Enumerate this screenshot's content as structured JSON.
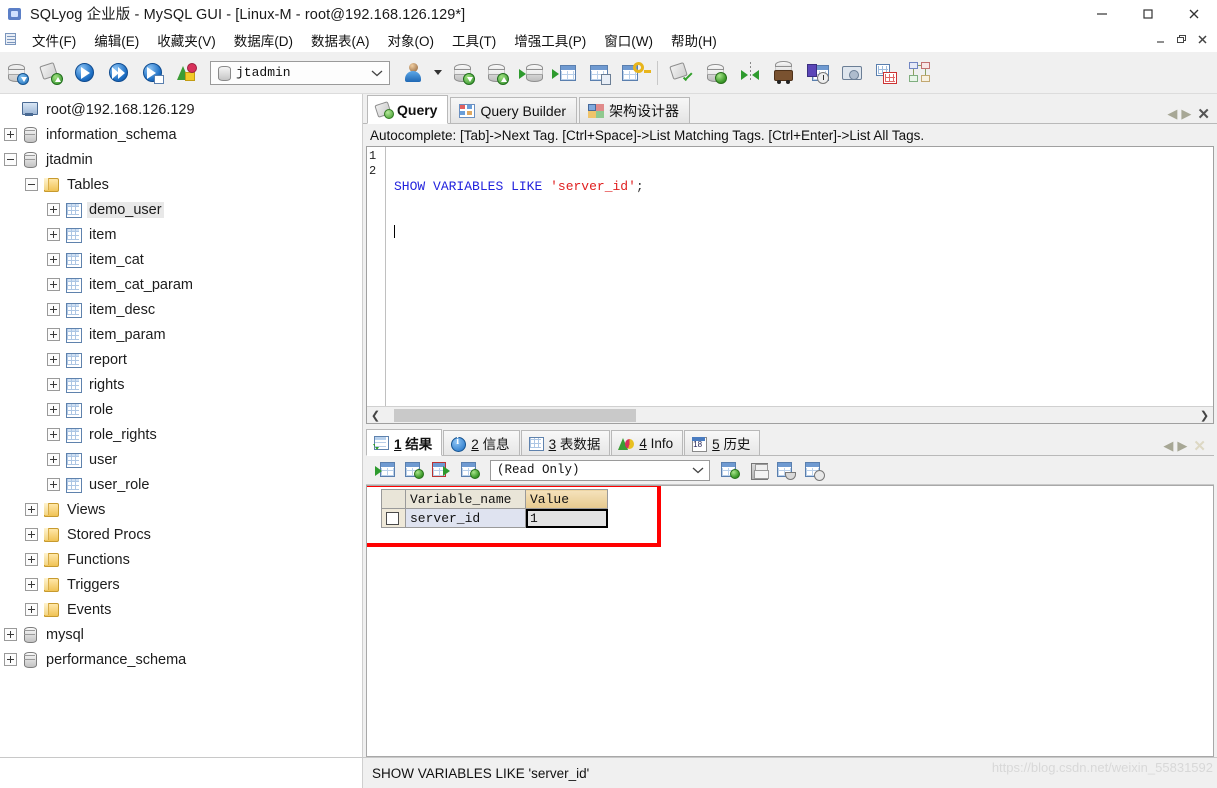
{
  "window": {
    "title": "SQLyog 企业版 - MySQL GUI - [Linux-M - root@192.168.126.129*]",
    "minimize": "—",
    "maximize": "□",
    "close": "✕",
    "mdi_minimize": "_",
    "mdi_restore": "❐",
    "mdi_close": "✕"
  },
  "menu": {
    "items": [
      {
        "label": "文件(F)",
        "mnemonic": "F"
      },
      {
        "label": "编辑(E)",
        "mnemonic": "E"
      },
      {
        "label": "收藏夹(V)",
        "mnemonic": "V"
      },
      {
        "label": "数据库(D)",
        "mnemonic": "D"
      },
      {
        "label": "数据表(A)",
        "mnemonic": "A"
      },
      {
        "label": "对象(O)",
        "mnemonic": "O"
      },
      {
        "label": "工具(T)",
        "mnemonic": "T"
      },
      {
        "label": "增强工具(P)",
        "mnemonic": "P"
      },
      {
        "label": "窗口(W)",
        "mnemonic": "W"
      },
      {
        "label": "帮助(H)",
        "mnemonic": "H"
      }
    ]
  },
  "toolbar": {
    "database_selector": {
      "value": "jtadmin",
      "chevron": "⌄"
    },
    "icons": [
      "new-connection-icon",
      "new-query-tab-icon",
      "execute-query-icon",
      "execute-all-queries-icon",
      "execute-query-new-tab-icon",
      "stop-execution-icon",
      "user-manager-icon",
      "user-manager-dropdown-icon",
      "backup-database-icon",
      "restore-database-icon",
      "import-external-data-icon",
      "export-table-data-icon",
      "table-diagnostics-icon",
      "manage-index-icon",
      "flush-icon",
      "database-sync-icon",
      "data-compare-icon",
      "migration-toolkit-icon",
      "scheduled-backup-icon",
      "sql-formatter-icon",
      "table-designer-icon",
      "schema-designer-icon"
    ]
  },
  "tree": {
    "nodes": [
      {
        "label": "root@192.168.126.129",
        "icon": "server-icon",
        "indent": 0,
        "expander": "none",
        "selected": false
      },
      {
        "label": "information_schema",
        "icon": "database-icon",
        "indent": 1,
        "expander": "plus",
        "selected": false
      },
      {
        "label": "jtadmin",
        "icon": "database-icon",
        "indent": 1,
        "expander": "minus",
        "selected": false
      },
      {
        "label": "Tables",
        "icon": "folder-icon",
        "indent": 2,
        "expander": "minus",
        "selected": false
      },
      {
        "label": "demo_user",
        "icon": "table-icon",
        "indent": 3,
        "expander": "plus",
        "selected": true
      },
      {
        "label": "item",
        "icon": "table-icon",
        "indent": 3,
        "expander": "plus",
        "selected": false
      },
      {
        "label": "item_cat",
        "icon": "table-icon",
        "indent": 3,
        "expander": "plus",
        "selected": false
      },
      {
        "label": "item_cat_param",
        "icon": "table-icon",
        "indent": 3,
        "expander": "plus",
        "selected": false
      },
      {
        "label": "item_desc",
        "icon": "table-icon",
        "indent": 3,
        "expander": "plus",
        "selected": false
      },
      {
        "label": "item_param",
        "icon": "table-icon",
        "indent": 3,
        "expander": "plus",
        "selected": false
      },
      {
        "label": "report",
        "icon": "table-icon",
        "indent": 3,
        "expander": "plus",
        "selected": false
      },
      {
        "label": "rights",
        "icon": "table-icon",
        "indent": 3,
        "expander": "plus",
        "selected": false
      },
      {
        "label": "role",
        "icon": "table-icon",
        "indent": 3,
        "expander": "plus",
        "selected": false
      },
      {
        "label": "role_rights",
        "icon": "table-icon",
        "indent": 3,
        "expander": "plus",
        "selected": false
      },
      {
        "label": "user",
        "icon": "table-icon",
        "indent": 3,
        "expander": "plus",
        "selected": false
      },
      {
        "label": "user_role",
        "icon": "table-icon",
        "indent": 3,
        "expander": "plus",
        "selected": false
      },
      {
        "label": "Views",
        "icon": "folder-icon",
        "indent": 2,
        "expander": "plus",
        "selected": false
      },
      {
        "label": "Stored Procs",
        "icon": "folder-icon",
        "indent": 2,
        "expander": "plus",
        "selected": false
      },
      {
        "label": "Functions",
        "icon": "folder-icon",
        "indent": 2,
        "expander": "plus",
        "selected": false
      },
      {
        "label": "Triggers",
        "icon": "folder-icon",
        "indent": 2,
        "expander": "plus",
        "selected": false
      },
      {
        "label": "Events",
        "icon": "folder-icon",
        "indent": 2,
        "expander": "plus",
        "selected": false
      },
      {
        "label": "mysql",
        "icon": "database-icon",
        "indent": 1,
        "expander": "plus",
        "selected": false
      },
      {
        "label": "performance_schema",
        "icon": "database-icon",
        "indent": 1,
        "expander": "plus",
        "selected": false
      }
    ]
  },
  "editor_tabs": {
    "tabs": [
      {
        "label": "Query",
        "icon": "query-icon",
        "active": true
      },
      {
        "label": "Query Builder",
        "icon": "query-builder-icon",
        "active": false
      },
      {
        "label": "架构设计器",
        "icon": "schema-designer-icon",
        "active": false
      }
    ],
    "nav_prev": "◀",
    "nav_next": "▶",
    "close": "✕"
  },
  "editor": {
    "hint": "Autocomplete: [Tab]->Next Tag. [Ctrl+Space]->List Matching Tags. [Ctrl+Enter]->List All Tags.",
    "line_numbers": [
      "1",
      "2"
    ],
    "sql": {
      "keyword1": "SHOW",
      "keyword2": "VARIABLES",
      "keyword3": "LIKE",
      "string": "'server_id'",
      "terminator": ";"
    },
    "scroll_prev": "❮",
    "scroll_next": "❯"
  },
  "result_tabs": {
    "tabs": [
      {
        "number": "1",
        "label": "结果",
        "icon": "result-grid-icon",
        "active": true
      },
      {
        "number": "2",
        "label": "信息",
        "icon": "message-info-icon",
        "active": false
      },
      {
        "number": "3",
        "label": "表数据",
        "icon": "table-data-icon",
        "active": false
      },
      {
        "number": "4",
        "label": "Info",
        "icon": "object-info-icon",
        "active": false
      },
      {
        "number": "5",
        "label": "历史",
        "icon": "history-calendar-icon",
        "active": false
      }
    ],
    "nav_prev": "◀",
    "nav_next": "▶",
    "close": "✕"
  },
  "result_toolbar": {
    "mode_selector": {
      "value": "(Read Only)",
      "chevron": "⌄"
    },
    "icons": [
      "insert-row-icon",
      "update-row-icon",
      "delete-row-icon",
      "refresh-data-icon",
      "export-results-icon",
      "save-results-icon",
      "apply-filter-icon",
      "clear-filter-icon"
    ]
  },
  "result_grid": {
    "columns": [
      "Variable_name",
      "Value"
    ],
    "highlighted_column": "Value",
    "rows": [
      {
        "checkbox": false,
        "Variable_name": "server_id",
        "Value": "1"
      }
    ],
    "selected_cell": {
      "row": 0,
      "column": "Value"
    }
  },
  "annotation": {
    "type": "red-rectangle-highlight",
    "color": "#ff0000"
  },
  "statusbar": {
    "text": "SHOW VARIABLES LIKE 'server_id'",
    "watermark": "https://blog.csdn.net/weixin_55831592"
  }
}
